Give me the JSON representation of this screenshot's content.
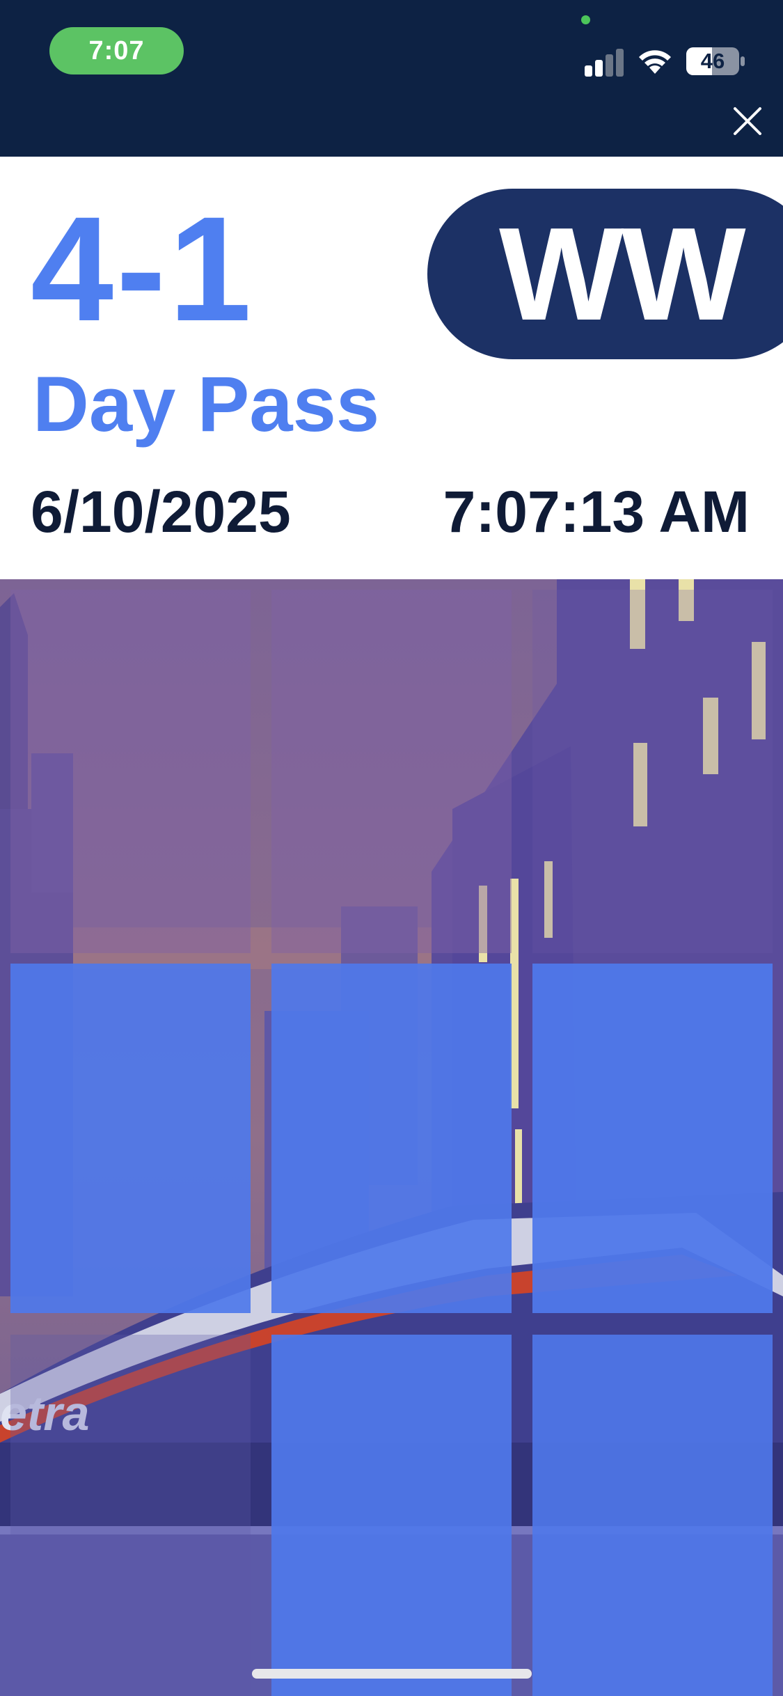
{
  "status_bar": {
    "time": "7:07",
    "battery_level": "46",
    "signal_bars": 2
  },
  "ticket": {
    "zone": "4-1",
    "pass_type": "Day Pass",
    "date": "6/10/2025",
    "time": "7:07:13 AM",
    "route_code": "WW"
  },
  "scene": {
    "train_logo": "metra",
    "colors": {
      "sky_top": "#7d6495",
      "sky_bottom": "#8f6f8a",
      "building_purple": "#5a4c9b",
      "tile_blue": "#4f78ea"
    }
  },
  "colors": {
    "header_background": "#0d2244",
    "accent_blue": "#4f7ff0",
    "pill_navy": "#1c3165",
    "time_pill_green": "#5cc364",
    "text_dark": "#0f1b36"
  },
  "icons": {
    "close": "close-icon",
    "wifi": "wifi-icon",
    "signal": "cellular-signal-icon",
    "battery": "battery-icon"
  }
}
